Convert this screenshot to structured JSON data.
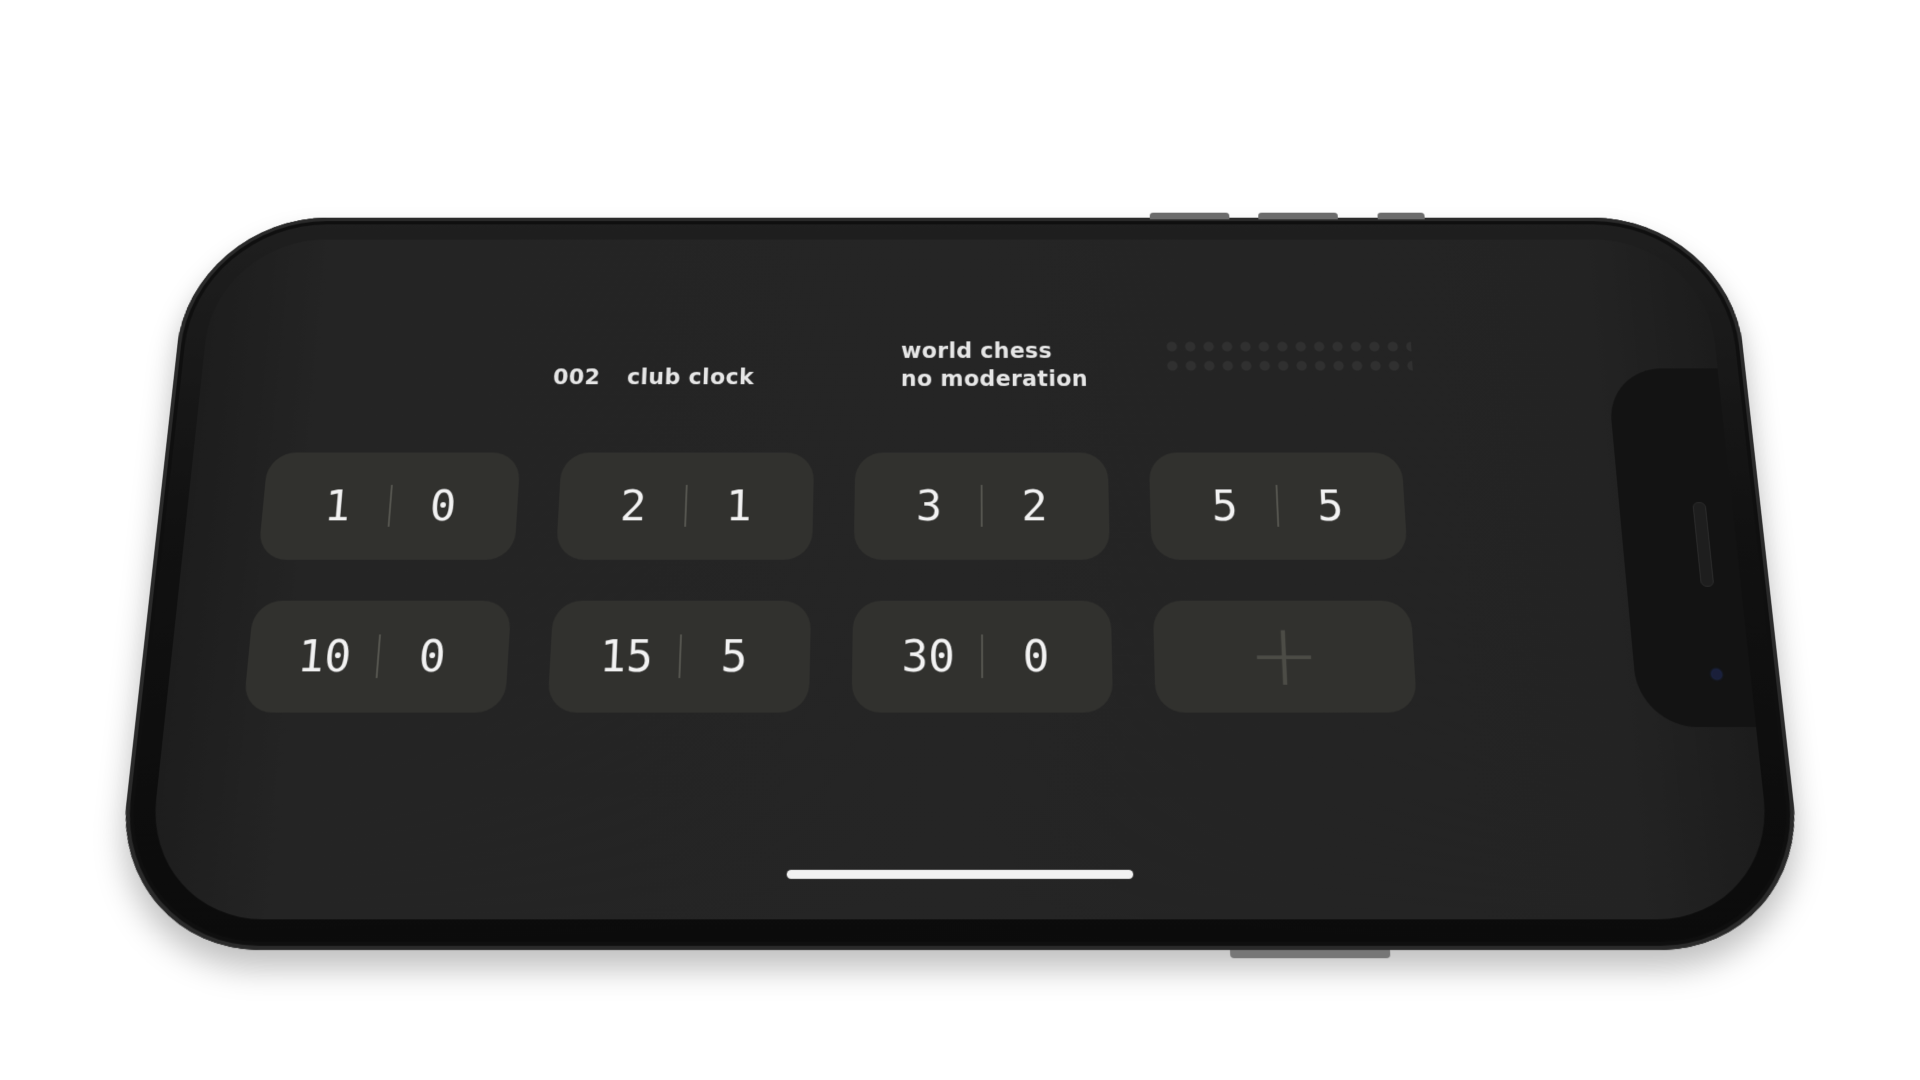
{
  "header": {
    "number": "002",
    "title": "club clock",
    "tagline_line1": "world chess",
    "tagline_line2": "no moderation"
  },
  "presets": [
    {
      "minutes": "1",
      "increment": "0"
    },
    {
      "minutes": "2",
      "increment": "1"
    },
    {
      "minutes": "3",
      "increment": "2"
    },
    {
      "minutes": "5",
      "increment": "5"
    },
    {
      "minutes": "10",
      "increment": "0"
    },
    {
      "minutes": "15",
      "increment": "5"
    },
    {
      "minutes": "30",
      "increment": "0"
    }
  ],
  "add_button": {
    "label": "+"
  },
  "icons": {
    "add": "plus-icon",
    "brand_pattern": "dot-grid-icon"
  },
  "colors": {
    "screen_background": "#252525",
    "tile_background": "#31312e",
    "text": "#f2f2f2"
  }
}
